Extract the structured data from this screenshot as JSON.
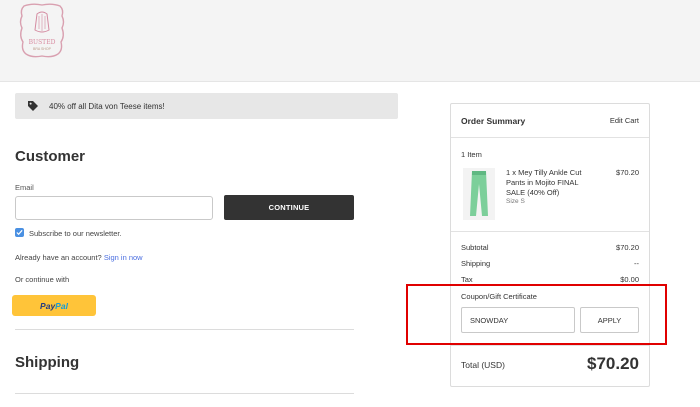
{
  "header": {
    "logo_name": "BUSTED",
    "logo_sub": "BRA SHOP"
  },
  "promo": {
    "text": "40% off all Dita von Teese items!",
    "icon": "tag-icon"
  },
  "customer": {
    "title": "Customer",
    "email_label": "Email",
    "email_value": "",
    "continue_label": "CONTINUE",
    "newsletter_label": "Subscribe to our newsletter.",
    "newsletter_checked": true,
    "account_prefix": "Already have an account?",
    "sign_in_link": "Sign in now",
    "or_continue": "Or continue with",
    "paypal_pay": "Pay",
    "paypal_pal": "Pal"
  },
  "shipping": {
    "title": "Shipping"
  },
  "order_summary": {
    "title": "Order Summary",
    "edit_cart": "Edit Cart",
    "item_count": "1 Item",
    "item": {
      "name_lines": [
        "1 x Mey Tilly Ankle Cut",
        "Pants in Mojito FINAL",
        "SALE (40% Off)"
      ],
      "size": "Size S",
      "price": "$70.20",
      "color": "#7ccf9a"
    },
    "subtotal_label": "Subtotal",
    "subtotal_value": "$70.20",
    "shipping_label": "Shipping",
    "shipping_value": "--",
    "tax_label": "Tax",
    "tax_value": "$0.00",
    "coupon_link": "Coupon/Gift Certificate",
    "coupon_value": "SNOWDAY",
    "apply_label": "APPLY",
    "total_label": "Total (USD)",
    "total_value": "$70.20"
  },
  "colors": {
    "accent_link": "#4a6ee0",
    "dark_button": "#333333",
    "highlight": "#e00000",
    "paypal_yellow": "#ffc439"
  }
}
